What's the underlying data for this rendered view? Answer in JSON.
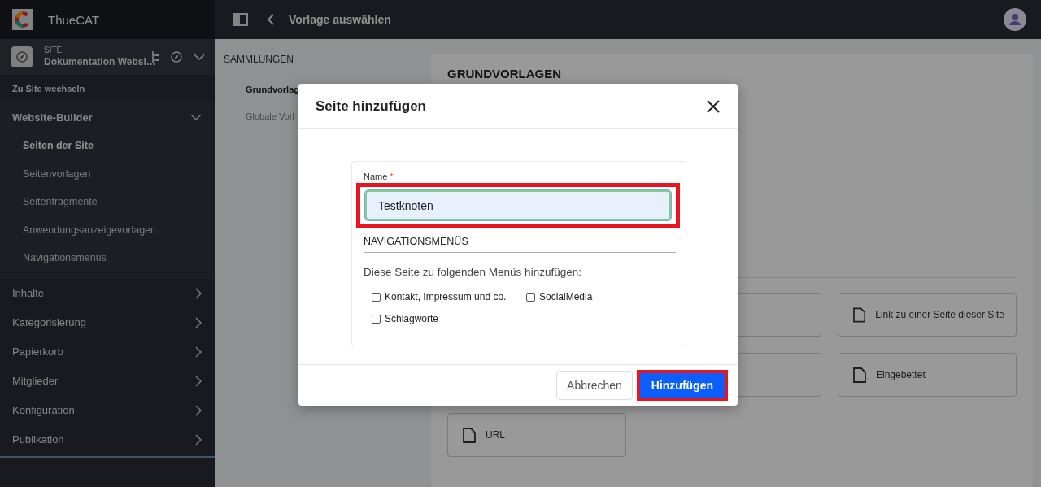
{
  "app": {
    "name": "ThueCAT"
  },
  "topbar": {
    "title": "Vorlage auswählen"
  },
  "site": {
    "label": "SITE",
    "name": "Dokumentation Websi…"
  },
  "sidebar": {
    "switch_link": "Zu Site wechseln",
    "sections": [
      {
        "label": "Website-Builder",
        "expanded": true,
        "children": [
          {
            "label": "Seiten der Site",
            "selected": true
          },
          {
            "label": "Seitenvorlagen",
            "selected": false
          },
          {
            "label": "Seitenfragmente",
            "selected": false
          },
          {
            "label": "Anwendungsanzeigevorlagen",
            "selected": false
          },
          {
            "label": "Navigationsmenüs",
            "selected": false
          }
        ]
      },
      {
        "label": "Inhalte",
        "expanded": false
      },
      {
        "label": "Kategorisierung",
        "expanded": false
      },
      {
        "label": "Papierkorb",
        "expanded": false
      },
      {
        "label": "Mitglieder",
        "expanded": false
      },
      {
        "label": "Konfiguration",
        "expanded": false
      },
      {
        "label": "Publikation",
        "expanded": false
      }
    ]
  },
  "collections": {
    "heading": "SAMMLUNGEN",
    "items": [
      {
        "label": "Grundvorlag",
        "selected": true
      },
      {
        "label": "Globale Vorl",
        "selected": false
      }
    ]
  },
  "templates": {
    "heading": "GRUNDVORLAGEN",
    "rows": [
      [
        {
          "kind": "covered"
        },
        {
          "kind": "template",
          "label": "Link zu einer Seite dieser Site"
        }
      ],
      [
        {
          "kind": "covered"
        },
        {
          "kind": "template",
          "label": "Eingebettet"
        }
      ],
      [
        {
          "kind": "template",
          "label": "URL"
        }
      ]
    ]
  },
  "dialog": {
    "title": "Seite hinzufügen",
    "name_field": {
      "label": "Name",
      "required_mark": "*",
      "value": "Testknoten",
      "highlighted": true
    },
    "section_title": "NAVIGATIONSMENÜS",
    "intro": "Diese Seite zu folgenden Menüs hinzufügen:",
    "menus": [
      {
        "label": "Kontakt, Impressum und co.",
        "checked": false
      },
      {
        "label": "SocialMedia",
        "checked": false
      },
      {
        "label": "Schlagworte",
        "checked": false
      }
    ],
    "cancel_button": "Abbrechen",
    "submit_button": {
      "label": "Hinzufügen",
      "highlighted": true
    }
  }
}
